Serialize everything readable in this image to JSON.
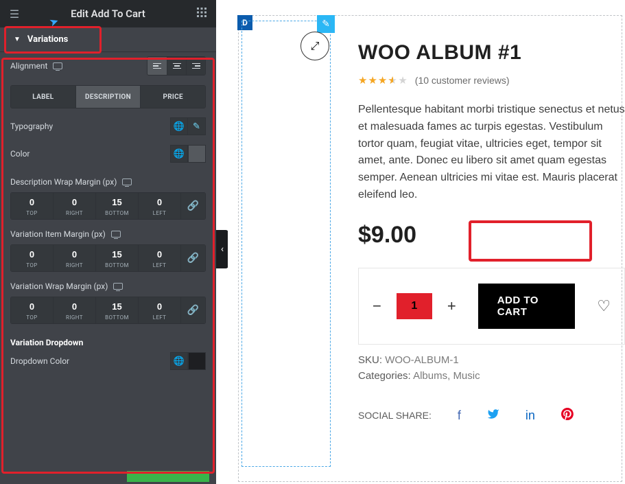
{
  "header": {
    "title": "Edit Add To Cart"
  },
  "section": {
    "title": "Variations"
  },
  "alignment": {
    "label": "Alignment"
  },
  "tabs": {
    "label": "LABEL",
    "description": "DESCRIPTION",
    "price": "PRICE"
  },
  "typography": {
    "label": "Typography"
  },
  "color": {
    "label": "Color"
  },
  "margins": {
    "desc_wrap": {
      "title": "Description Wrap Margin (px)",
      "top": "0",
      "right": "0",
      "bottom": "15",
      "left": "0"
    },
    "item": {
      "title": "Variation Item Margin (px)",
      "top": "0",
      "right": "0",
      "bottom": "15",
      "left": "0"
    },
    "var_wrap": {
      "title": "Variation Wrap Margin (px)",
      "top": "0",
      "right": "0",
      "bottom": "15",
      "left": "0"
    },
    "sides": {
      "top": "TOP",
      "right": "RIGHT",
      "bottom": "BOTTOM",
      "left": "LEFT"
    }
  },
  "dropdown": {
    "heading": "Variation Dropdown",
    "color_label": "Dropdown Color"
  },
  "widget_handle": "D",
  "product": {
    "title": "WOO ALBUM #1",
    "reviews": "(10 customer reviews)",
    "description": "Pellentesque habitant morbi tristique senectus et netus et malesuada fames ac turpis egestas. Vestibulum tortor quam, feugiat vitae, ultricies eget, tempor sit amet, ante. Donec eu libero sit amet quam egestas semper. Aenean ultricies mi vitae est. Mauris placerat eleifend leo.",
    "price": "$9.00",
    "qty": "1",
    "add_to_cart": "ADD TO CART",
    "sku_label": "SKU:",
    "sku": "WOO-ALBUM-1",
    "cat_label": "Categories:",
    "cat1": "Albums",
    "cat2": "Music",
    "share_label": "SOCIAL SHARE:"
  }
}
